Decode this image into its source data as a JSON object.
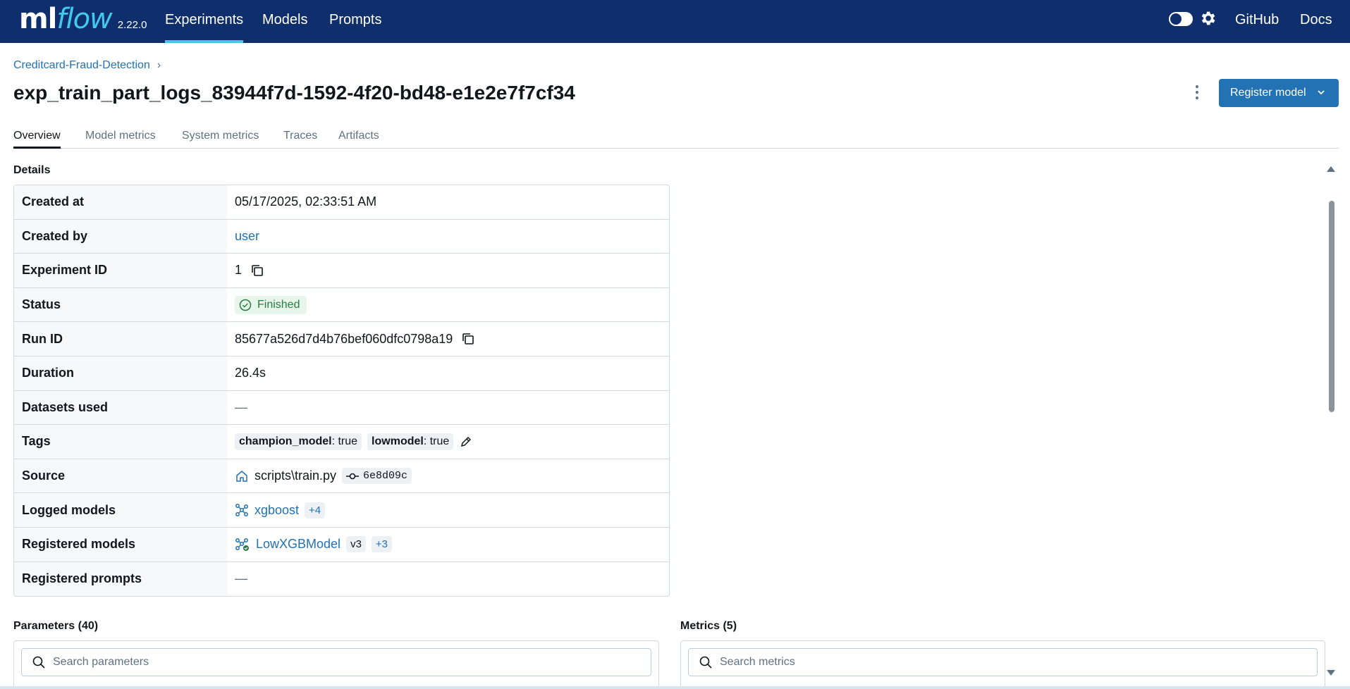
{
  "app": {
    "logo_ml": "ml",
    "logo_flow": "flow",
    "version": "2.22.0",
    "nav": {
      "experiments": "Experiments",
      "models": "Models",
      "prompts": "Prompts",
      "github": "GitHub",
      "docs": "Docs"
    }
  },
  "header": {
    "breadcrumb": "Creditcard-Fraud-Detection",
    "title": "exp_train_part_logs_83944f7d-1592-4f20-bd48-e1e2e7f7cf34",
    "register_label": "Register model"
  },
  "tabs": [
    "Overview",
    "Model metrics",
    "System metrics",
    "Traces",
    "Artifacts"
  ],
  "details": {
    "label": "Details",
    "created_at_key": "Created at",
    "created_at": "05/17/2025, 02:33:51 AM",
    "created_by_key": "Created by",
    "created_by": "user",
    "experiment_id_key": "Experiment ID",
    "experiment_id": "1",
    "status_key": "Status",
    "status": "Finished",
    "run_id_key": "Run ID",
    "run_id": "85677a526d7d4b76bef060dfc0798a19",
    "duration_key": "Duration",
    "duration": "26.4s",
    "datasets_key": "Datasets used",
    "datasets": "—",
    "tags_key": "Tags",
    "tag1_key": "champion_model",
    "tag1_val": ": true",
    "tag2_key": "lowmodel",
    "tag2_val": ": true",
    "source_key": "Source",
    "source": "scripts\\train.py",
    "commit": "6e8d09c",
    "logged_models_key": "Logged models",
    "logged_model": "xgboost",
    "logged_more": "+4",
    "registered_models_key": "Registered models",
    "registered_model": "LowXGBModel",
    "registered_version": "v3",
    "registered_more": "+3",
    "registered_prompts_key": "Registered prompts",
    "registered_prompts": "—"
  },
  "parameters": {
    "label": "Parameters (40)",
    "placeholder": "Search parameters"
  },
  "metrics": {
    "label": "Metrics (5)",
    "placeholder": "Search metrics"
  },
  "colors": {
    "nav_bg": "#0e2f6b",
    "accent": "#43c9ed",
    "primary": "#2272b4",
    "success": "#277c43"
  }
}
